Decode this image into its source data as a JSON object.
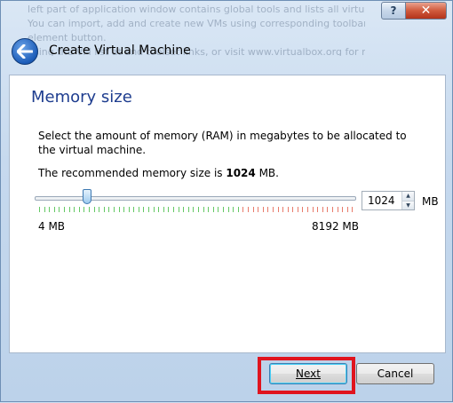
{
  "background_text": {
    "lines": [
      "left part of application window contains global tools and lists all virtual",
      "You can import, add and create new VMs using corresponding toolbar buttons",
      "element button.",
      "using the VM list at and toolset links, or visit www.virtualbox.org for more de"
    ]
  },
  "title_bar": {
    "help_label": "?",
    "close_label": "✕"
  },
  "header": {
    "title": "Create Virtual Machine",
    "back_icon": "back-arrow-icon"
  },
  "page": {
    "section_title": "Memory size",
    "description": "Select the amount of memory (RAM) in megabytes to be allocated to the virtual machine.",
    "recommended_prefix": "The recommended memory size is ",
    "recommended_value": "1024",
    "recommended_suffix": " MB.",
    "slider": {
      "min_label": "4 MB",
      "max_label": "8192 MB",
      "min_value": 4,
      "max_value": 8192,
      "value": 1024,
      "zone_colors": {
        "green": "#64c864",
        "red": "#e87a6a"
      }
    },
    "spinbox": {
      "value": "1024",
      "unit": "MB"
    }
  },
  "footer": {
    "next_label": "Next",
    "cancel_label": "Cancel"
  },
  "colors": {
    "accent_title": "#1e3d8f",
    "highlight": "#e0141e"
  }
}
